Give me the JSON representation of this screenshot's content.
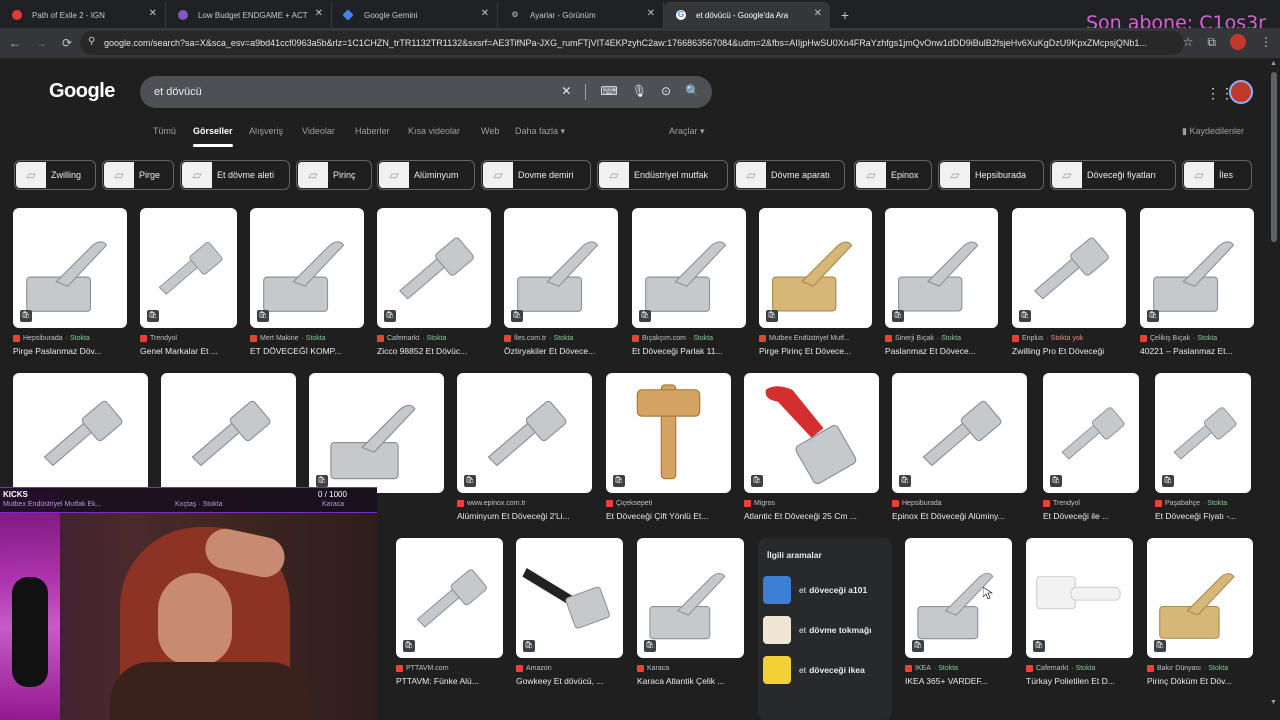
{
  "browser": {
    "tabs": [
      {
        "title": "Path of Exile 2 - IGN",
        "active": false,
        "favicon_color": "#e53935"
      },
      {
        "title": "Low Budget ENDGAME + ACT",
        "active": false,
        "favicon_color": "#7e57c2"
      },
      {
        "title": "Google Gemini",
        "active": false,
        "favicon_color": "#4285f4"
      },
      {
        "title": "Ayarlar - Görünüm",
        "active": false,
        "favicon_color": "#9aa0a6"
      },
      {
        "title": "et dövücü - Google'da Ara",
        "active": true,
        "favicon_color": "#ffffff"
      }
    ],
    "new_tab": "+",
    "url": "google.com/search?sa=X&sca_esv=a9bd41ccf0963a5b&rlz=1C1CHZN_trTR1132TR1132&sxsrf=AE3TifNPa-JXG_rumFTjVIT4EKPzyhC2aw:1766863567084&udm=2&fbs=AIIjpHwSU0Xn4FRaYzhfgs1jmQvOnw1dDD9iBulB2fsjeHv6XuKgDzU9KpxZMcpsjQNb1..."
  },
  "overlay": {
    "subscriber_text": "Son abone: C1os3r"
  },
  "google": {
    "logo": "Google",
    "query": "et dövücü",
    "nav_tabs": [
      {
        "label": "Tümü",
        "active": false
      },
      {
        "label": "Görseller",
        "active": true
      },
      {
        "label": "Alışveriş",
        "active": false
      },
      {
        "label": "Videolar",
        "active": false
      },
      {
        "label": "Haberler",
        "active": false
      },
      {
        "label": "Kısa videolar",
        "active": false
      },
      {
        "label": "Web",
        "active": false
      },
      {
        "label": "Daha fazla",
        "active": false
      },
      {
        "label": "Araçlar",
        "active": false
      }
    ],
    "saved_label": "Kaydedilenler",
    "chips": [
      "Zwilling",
      "Pirge",
      "Et dövme aleti",
      "Pirinç",
      "Alüminyum",
      "Dovme demiri",
      "Endüstriyel mutfak",
      "Dövme aparatı",
      "Epinox",
      "Hepsiburada",
      "Döveceği fiyatları",
      "İles"
    ],
    "row1": [
      {
        "source": "Hepsiburada",
        "stock": "Stokta",
        "title": "Pirge Paslanmaz Döv..."
      },
      {
        "source": "Trendyol",
        "stock": "",
        "title": "Genel Markalar Et ..."
      },
      {
        "source": "Mert Makine",
        "stock": "Stokta",
        "title": "ET DÖVECEĞİ KOMP..."
      },
      {
        "source": "Cafemarkt",
        "stock": "Stokta",
        "title": "Zicco 98852 Et Dövüc..."
      },
      {
        "source": "İles.com.tr",
        "stock": "Stokta",
        "title": "Öztiryakiler Et Dövece..."
      },
      {
        "source": "Bıçakçım.com",
        "stock": "Stokta",
        "title": "Et Döveceği Parlak 11..."
      },
      {
        "source": "Mutbex Endüstriyel Mutf...",
        "stock": "",
        "title": "Pirge Pirinç Et Dövece..."
      },
      {
        "source": "Sinerji Bıçak",
        "stock": "Stokta",
        "title": "Paslanmaz Et Dövece..."
      },
      {
        "source": "Enplus",
        "stock": "Stokta yok",
        "title": "Zwilling Pro Et Döveceği"
      },
      {
        "source": "Çelikiş Bıçak",
        "stock": "Stokta",
        "title": "40221 – Paslanmaz Et..."
      }
    ],
    "row2": [
      {
        "source": "Mutbex Endüstriyel Mutfak Ek...",
        "stock": "",
        "title": ""
      },
      {
        "source": "Koçtaş",
        "stock": "Stokta",
        "title": ""
      },
      {
        "source": "Karaca",
        "stock": "",
        "title": "Paslanmaz Ç..."
      },
      {
        "source": "www.epinox.com.tr",
        "stock": "",
        "title": "Alüminyum Et Döveceği 2'Li..."
      },
      {
        "source": "Çiçeksepeti",
        "stock": "",
        "title": "Et Döveceği Çift Yönlü Et..."
      },
      {
        "source": "Migros",
        "stock": "",
        "title": "Atlantic Et Döveceği 25 Cm ..."
      },
      {
        "source": "Hepsiburada",
        "stock": "",
        "title": "Epinox Et Döveceği Alüminy..."
      },
      {
        "source": "Trendyol",
        "stock": "",
        "title": "Et Döveceği ile ..."
      },
      {
        "source": "Paşabahçe",
        "stock": "Stokta",
        "title": "Et Döveceği Fiyatı -..."
      }
    ],
    "row3": [
      {
        "source": "PTTAVM.com",
        "stock": "",
        "title": "PTTAVM: Fünke Alü..."
      },
      {
        "source": "Amazon",
        "stock": "",
        "title": "Gowkeey Et dövücü, ..."
      },
      {
        "source": "Karaca",
        "stock": "",
        "title": "Karaca Atlantik Çelik ..."
      },
      {
        "source": "IKEA",
        "stock": "Stokta",
        "title": "IKEA 365+ VARDEF..."
      },
      {
        "source": "Cafemarkt",
        "stock": "Stokta",
        "title": "Türkay Polietilen Et D..."
      },
      {
        "source": "Bakır Dünyası",
        "stock": "Stokta",
        "title": "Pirinç Döküm Et Döv..."
      }
    ],
    "related": {
      "title": "İlgili aramalar",
      "items": [
        {
          "pre": "et",
          "bold": "döveceği a101"
        },
        {
          "pre": "et",
          "bold": "dövme tokmağı"
        },
        {
          "pre": "et",
          "bold": "döveceği ikea"
        }
      ]
    }
  },
  "kicks": {
    "label": "KICKS",
    "count": "0 / 1000",
    "progress": 0
  }
}
